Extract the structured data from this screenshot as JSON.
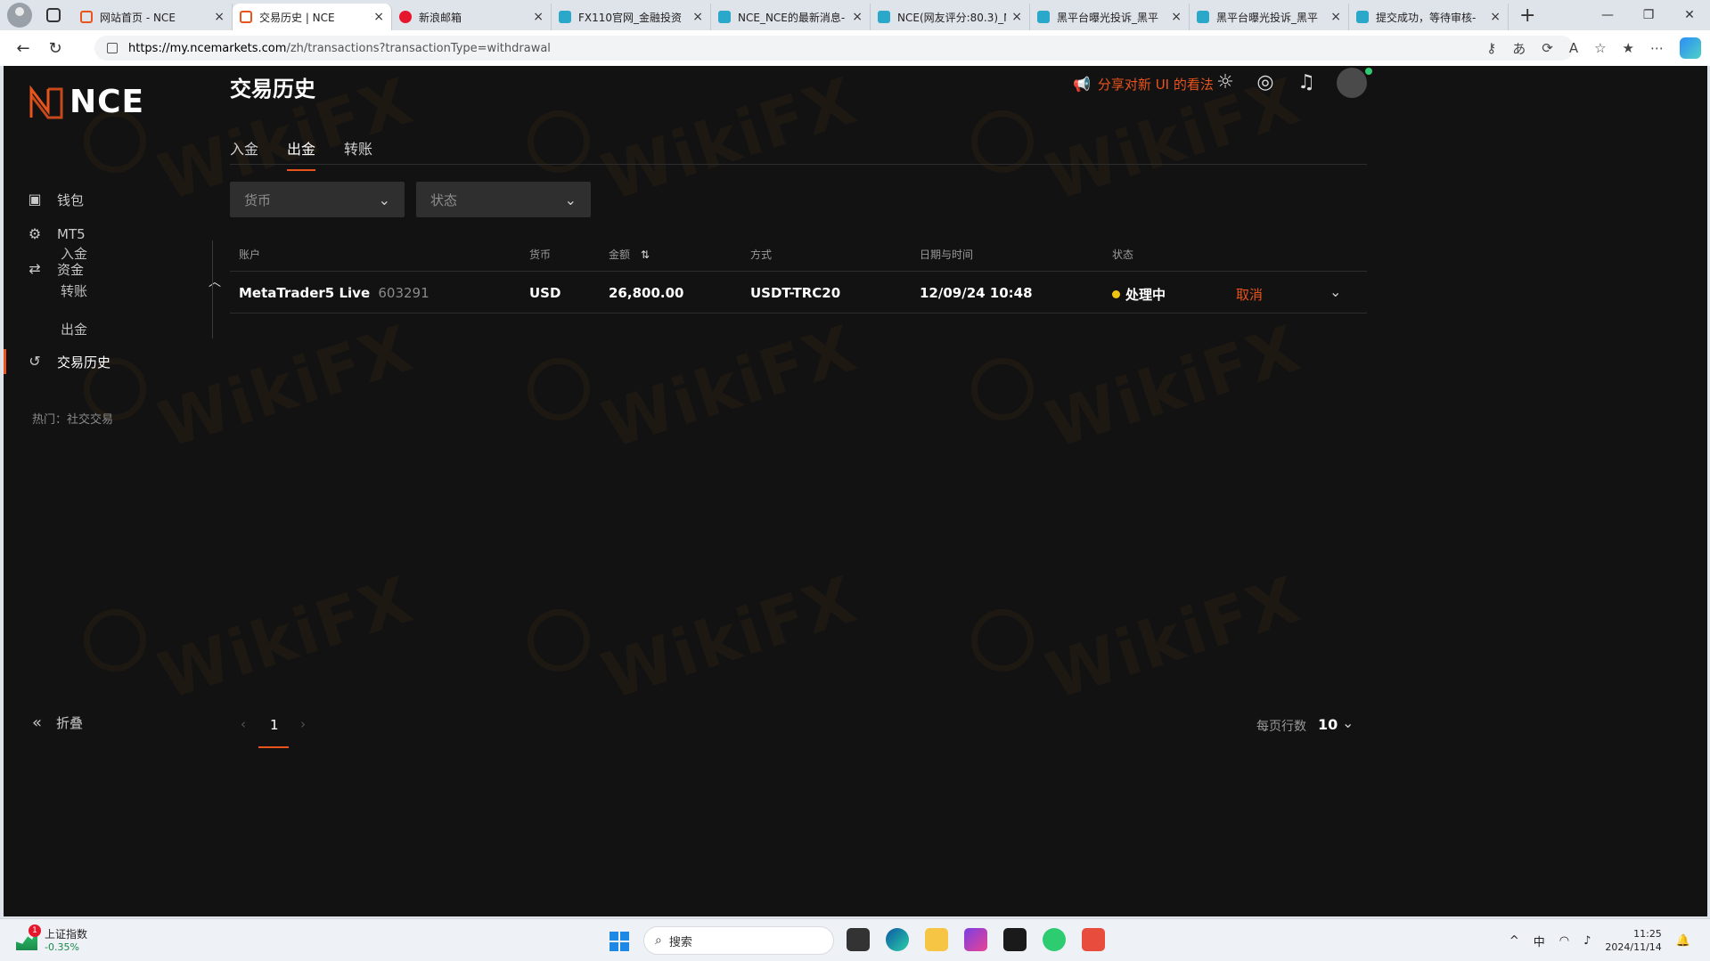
{
  "browser": {
    "tabs": [
      {
        "title": "网站首页 - NCE",
        "icon": "nce-icon",
        "active": false
      },
      {
        "title": "交易历史 | NCE",
        "icon": "nce-icon",
        "active": true
      },
      {
        "title": "新浪邮箱",
        "icon": "weibo-icon",
        "active": false
      },
      {
        "title": "FX110官网_金融投资",
        "icon": "wikifx-icon",
        "active": false
      },
      {
        "title": "NCE_NCE的最新消息-",
        "icon": "wikifx-icon",
        "active": false
      },
      {
        "title": "NCE(网友评分:80.3)_N",
        "icon": "wikifx-icon",
        "active": false
      },
      {
        "title": "黑平台曝光投诉_黑平",
        "icon": "wikifx-icon",
        "active": false
      },
      {
        "title": "黑平台曝光投诉_黑平",
        "icon": "wikifx-icon",
        "active": false
      },
      {
        "title": "提交成功，等待审核-",
        "icon": "wikifx-icon",
        "active": false
      }
    ],
    "url_host": "https://my.ncemarkets.com",
    "url_path": "/zh/transactions?transactionType=withdrawal"
  },
  "sidebar": {
    "logo": "NCE",
    "items": {
      "wallet": "钱包",
      "mt5": "MT5",
      "funds": "资金",
      "deposit": "入金",
      "transfer": "转账",
      "withdraw": "出金",
      "history": "交易历史"
    },
    "hot": "热门：社交交易",
    "collapse": "折叠"
  },
  "header": {
    "title": "交易历史",
    "share": "分享对新 UI 的看法"
  },
  "tabs": {
    "deposit": "入金",
    "withdraw": "出金",
    "transfer": "转账"
  },
  "filters": {
    "currency": "货币",
    "status": "状态"
  },
  "table": {
    "headers": {
      "account": "账户",
      "currency": "货币",
      "amount": "金额",
      "method": "方式",
      "datetime": "日期与时间",
      "status": "状态"
    },
    "rows": [
      {
        "account": "MetaTrader5 Live",
        "account_no": "603291",
        "currency": "USD",
        "amount": "26,800.00",
        "method": "USDT-TRC20",
        "datetime": "12/09/24 10:48",
        "status": "处理中",
        "action": "取消"
      }
    ]
  },
  "pagination": {
    "current": "1",
    "rows_label": "每页行数",
    "rows_value": "10"
  },
  "watermark": "WikiFX",
  "taskbar": {
    "stock_name": "上证指数",
    "stock_change": "-0.35%",
    "stock_badge": "1",
    "search": "搜索",
    "ime": "中",
    "time": "11:25",
    "date": "2024/11/14"
  },
  "colors": {
    "accent": "#e8541c",
    "background": "#121212",
    "status_pending": "#f1c40f"
  }
}
